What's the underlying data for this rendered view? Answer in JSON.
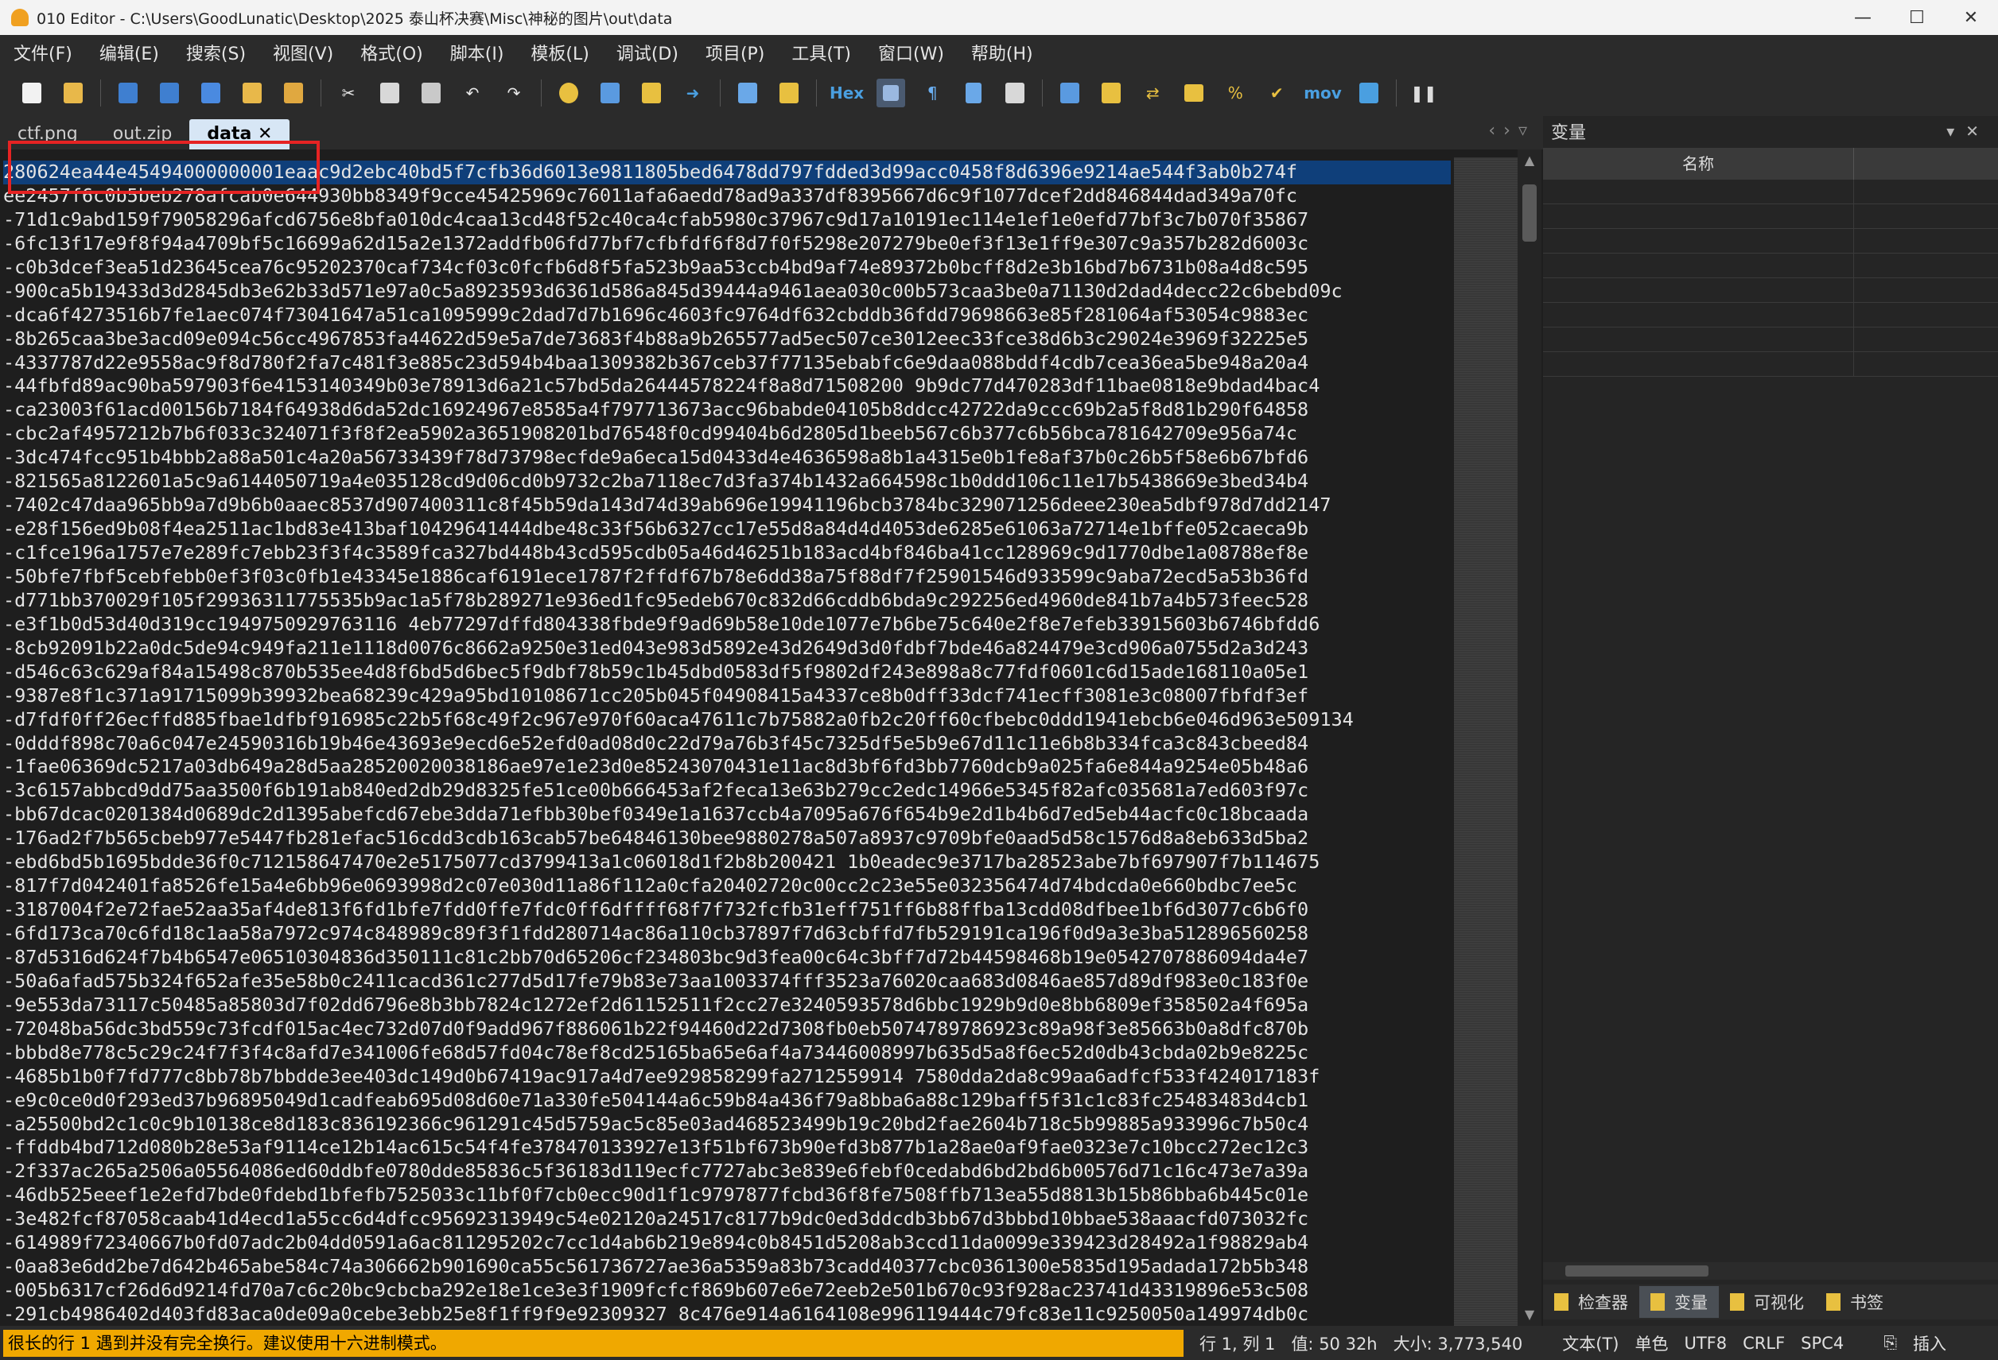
{
  "window": {
    "title": "010 Editor - C:\\Users\\GoodLunatic\\Desktop\\2025 泰山杯决赛\\Misc\\神秘的图片\\out\\data",
    "minimize": "—",
    "maximize": "☐",
    "close": "✕"
  },
  "menu": [
    "文件(F)",
    "编辑(E)",
    "搜索(S)",
    "视图(V)",
    "格式(O)",
    "脚本(I)",
    "模板(L)",
    "调试(D)",
    "项目(P)",
    "工具(T)",
    "窗口(W)",
    "帮助(H)"
  ],
  "toolbar": {
    "hex_label": "Hex",
    "mov_label": "mov",
    "icons": [
      "new-file-icon",
      "open-folder-icon",
      "save-icon",
      "save-as-icon",
      "save-all-icon",
      "open-dir-icon",
      "workspace-icon",
      "cut-icon",
      "copy-icon",
      "paste-icon",
      "undo-icon",
      "redo-icon",
      "find-icon",
      "replace-icon",
      "goto-icon",
      "jump-icon",
      "script-icon",
      "template-icon",
      "hex-mode-icon",
      "text-mode-icon",
      "paragraph-icon",
      "columns-icon",
      "highlight-icon",
      "calculator-icon",
      "inspector-icon",
      "compare-icon",
      "histogram-icon",
      "percent-icon",
      "checksum-icon",
      "mov-icon",
      "base-convert-icon",
      "pause-icon"
    ]
  },
  "tabs": [
    {
      "label": "ctf.png"
    },
    {
      "label": "out.zip"
    },
    {
      "label": "data",
      "close": "✕",
      "active": true
    }
  ],
  "editor": {
    "lines": [
      "280624ea44e45494000000001eaac9d2ebc40bd5f7cfb36d6013e9811805bed6478dd797fdded3d99acc0458f8d6396e9214ae544f3ab0b274f",
      "ee2457f6c0b5beb278afcab0e644930bb8349f9cce45425969c76011afa6aedd78ad9a337df8395667d6c9f1077dcef2dd846844dad349a70fc",
      "-71d1c9abd159f79058296afcd6756e8bfa010dc4caa13cd48f52c40ca4cfab5980c37967c9d17a10191ec114e1ef1e0efd77bf3c7b070f35867",
      "-6fc13f17e9f8f94a4709bf5c16699a62d15a2e1372addfb06fd77bf7cfbfdf6f8d7f0f5298e207279be0ef3f13e1ff9e307c9a357b282d6003c",
      "-c0b3dcef3ea51d23645cea76c95202370caf734cf03c0fcfb6d8f5fa523b9aa53ccb4bd9af74e89372b0bcff8d2e3b16bd7b6731b08a4d8c595",
      "-900ca5b19433d3d2845db3e62b33d571e97a0c5a8923593d6361d586a845d39444a9461aea030c00b573caa3be0a71130d2dad4decc22c6bebd09c",
      "-dca6f4273516b7fe1aec074f73041647a51ca1095999c2dad7d7b1696c4603fc9764df632cbddb36fdd79698663e85f281064af53054c9883ec",
      "-8b265caa3be3acd09e094c56cc4967853fa44622d59e5a7de73683f4b88a9b265577ad5ec507ce3012eec33fce38d6b3c29024e3969f32225e5",
      "-4337787d22e9558ac9f8d780f2fa7c481f3e885c23d594b4baa1309382b367ceb37f77135ebabfc6e9daa088bddf4cdb7cea36ea5be948a20a4",
      "-44fbfd89ac90ba597903f6e4153140349b03e78913d6a21c57bd5da26444578224f8a8d71508200 9b9dc77d470283df11bae0818e9bdad4bac4",
      "-ca23003f61acd00156b7184f64938d6da52dc16924967e8585a4f797713673acc96babde04105b8ddcc42722da9ccc69b2a5f8d81b290f64858",
      "-cbc2af4957212b7b6f033c324071f3f8f2ea5902a3651908201bd76548f0cd99404b6d2805d1beeb567c6b377c6b56bca781642709e956a74c",
      "-3dc474fcc951b4bbb2a88a501c4a20a56733439f78d73798ecfde9a6eca15d0433d4e4636598a8b1a4315e0b1fe8af37b0c26b5f58e6b67bfd6",
      "-821565a8122601a5c9a6144050719a4e035128cd9d06cd0b9732c2ba7118ec7d3fa374b1432a664598c1b0ddd106c11e17b5438669e3bed34b4",
      "-7402c47daa965bb9a7d9b6b0aaec8537d907400311c8f45b59da143d74d39ab696e19941196bcb3784bc329071256deee230ea5dbf978d7dd2147",
      "-e28f156ed9b08f4ea2511ac1bd83e413baf10429641444dbe48c33f56b6327cc17e55d8a84d4d4053de6285e61063a72714e1bffe052caeca9b",
      "-c1fce196a1757e7e289fc7ebb23f3f4c3589fca327bd448b43cd595cdb05a46d46251b183acd4bf846ba41cc128969c9d1770dbe1a08788ef8e",
      "-50bfe7fbf5cebfebb0ef3f03c0fb1e43345e1886caf6191ece1787f2ffdf67b78e6dd38a75f88df7f25901546d933599c9aba72ecd5a53b36fd",
      "-d771bb370029f105f29936311775535b9ac1a5f78b289271e936ed1fc95edeb670c832d66cddb6bda9c292256ed4960de841b7a4b573feec528",
      "-e3f1b0d53d40d319cc1949750929763116 4eb77297dffd804338fbde9f9ad69b58e10de1077e7b6be75c640e2f8e7efeb33915603b6746bfdd6",
      "-8cb92091b22a0dc5de94c949fa211e1118d0076c8662a9250e31ed043e983d5892e43d2649d3d0fdbf7bde46a824479e3cd906a0755d2a3d243",
      "-d546c63c629af84a15498c870b535ee4d8f6bd5d6bec5f9dbf78b59c1b45dbd0583df5f9802df243e898a8c77fdf0601c6d15ade168110a05e1",
      "-9387e8f1c371a91715099b39932bea68239c429a95bd10108671cc205b045f04908415a4337ce8b0dff33dcf741ecff3081e3c08007fbfdf3ef",
      "-d7fdf0ff26ecffd885fbae1dfbf916985c22b5f68c49f2c967e970f60aca47611c7b75882a0fb2c20ff60cfbebc0ddd1941ebcb6e046d963e509134",
      "-0dddf898c70a6c047e24590316b19b46e43693e9ecd6e52efd0ad08d0c22d79a76b3f45c7325df5e5b9e67d11c11e6b8b334fca3c843cbeed84",
      "-1fae06369dc5217a03db649a28d5aa28520020038186ae97e1e23d0e85243070431e11ac8d3bf6fd3bb7760dcb9a025fa6e844a9254e05b48a6",
      "-3c6157abbcd9dd75aa3500f6b191ab840ed2db29d8325fe51ce00b666453af2feca13e63b279cc2edc14966e5345f82afc035681a7ed603f97c",
      "-bb67dcac0201384d0689dc2d1395abefcd67ebe3dda71efbb30bef0349e1a1637ccb4a7095a676f654b9e2d1b4b6d7ed5eb44acfc0c18bcaada",
      "-176ad2f7b565cbeb977e5447fb281efac516cdd3cdb163cab57be64846130bee9880278a507a8937c9709bfe0aad5d58c1576d8a8eb633d5ba2",
      "-ebd6bd5b1695bdde36f0c712158647470e2e5175077cd3799413a1c06018d1f2b8b200421 1b0eadec9e3717ba28523abe7bf697907f7b114675",
      "-817f7d042401fa8526fe15a4e6bb96e0693998d2c07e030d11a86f112a0cfa20402720c00cc2c23e55e032356474d74bdcda0e660bdbc7ee5c",
      "-3187004f2e72fae52aa35af4de813f6fd1bfe7fdd0ffe7fdc0ff6dffff68f7f732fcfb31eff751ff6b88ffba13cdd08dfbee1bf6d3077c6b6f0",
      "-6fd173ca70c6fd18c1aa58a7972c974c848989c89f3f1fdd280714ac86a110cb37897f7d63cbffd7fb529191ca196f0d9a3e3ba512896560258",
      "-87d5316d624f7b4b6547e06510304836d350111c81c2bb70d65206cf234803bc9d3fea00c64c3bff7d72b44598468b19e0542707886094da4e7",
      "-50a6afad575b324f652afe35e58b0c2411cacd361c277d5d17fe79b83e73aa1003374fff3523a76020caa683d0846ae857d89df983e0c183f0e",
      "-9e553da73117c50485a85803d7f02dd6796e8b3bb7824c1272ef2d61152511f2cc27e3240593578d6bbc1929b9d0e8bb6809ef358502a4f695a",
      "-72048ba56dc3bd559c73fcdf015ac4ec732d07d0f9add967f886061b22f94460d22d7308fb0eb5074789786923c89a98f3e85663b0a8dfc870b",
      "-bbbd8e778c5c29c24f7f3f4c8afd7e341006fe68d57fd04c78ef8cd25165ba65e6af4a73446008997b635d5a8f6ec52d0db43cbda02b9e8225c",
      "-4685b1b0f7fd777c8bb78b7bbdde3ee403dc149d0b67419ac917a4d7ee929858299fa2712559914 7580dda2da8c99aa6adfcf533f424017183f",
      "-e9c0ce0d0f293ed37b96895049d1cadfeab695d08d60e71a330fe504144a6c59b84a436f79a8bba6a88c129baff5f31c1c83fc25483483d4cb1",
      "-a25500bd2c1c0c9b10138ce8d183c836192366c961291c45d5759ac5c85e03ad468523499b19c20bd2fae2604b718c5b99885a933996c7b50c4",
      "-ffddb4bd712d080b28e53af9114ce12b14ac615c54f4fe378470133927e13f51bf673b90efd3b877b1a28ae0af9fae0323e7c10bcc272ec12c3",
      "-2f337ac265a2506a05564086ed60ddbfe0780dde85836c5f36183d119ecfc7727abc3e839e6febf0cedabd6bd2bd6b00576d71c16c473e7a39a",
      "-46db525eeef1e2efd7bde0fdebd1bfefb7525033c11bf0f7cb0ecc90d1f1c9797877fcbd36f8fe7508ffb713ea55d8813b15b86bba6b445c01e",
      "-3e482fcf87058caab41d4ecd1a55cc6d4dfcc95692313949c54e02120a24517c8177b9dc0ed3ddcdb3bb67d3bbbd10bbae538aaacfd073032fc",
      "-614989f72340667b0fd07adc2b04dd0591a6ac811295202c7cc1d4ab6b219e894c0b8451d5208ab3ccd11da0099e339423d28492a1f98829ab4",
      "-0aa83e6dd2be7d642b465abe584c74a306662b901690ca55c561736727ae36a5359a83b73cadd40377cbc0361300e5835d195adada172b5b348",
      "-005b6317cf26d6d9214fd70a7c6c20bc9cbcba292e18e1ce3e3f1909fcfcf869b607e6e72eeb2e501b670c93f928ac23741d43319896e53c508",
      "-291cb4986402d403fd83aca0de09a0cebe3ebb25e8f1ff9f9e92309327 8c476e914a6164108e996119444c79fc83e11c9250050a149974db0c"
    ]
  },
  "right_panel": {
    "title": "变量",
    "column_name": "名称",
    "tabs": [
      "检查器",
      "变量",
      "可视化",
      "书签"
    ],
    "active_tab": "变量"
  },
  "status": {
    "warning": "很长的行 1 遇到并没有完全换行。建议使用十六进制模式。",
    "position": "行 1, 列 1",
    "value": "值: 50 32h",
    "size": "大小: 3,773,540",
    "mode": "文本(T)",
    "char": "单色",
    "encoding": "UTF8",
    "eol": "CRLF",
    "tab": "SPC4",
    "insert": "插入"
  },
  "colors": {
    "selection": "#2f6fc0",
    "highlight_box": "#e62323",
    "warning_bg": "#f0a800",
    "active_tab_bg": "#d7e6f5"
  }
}
